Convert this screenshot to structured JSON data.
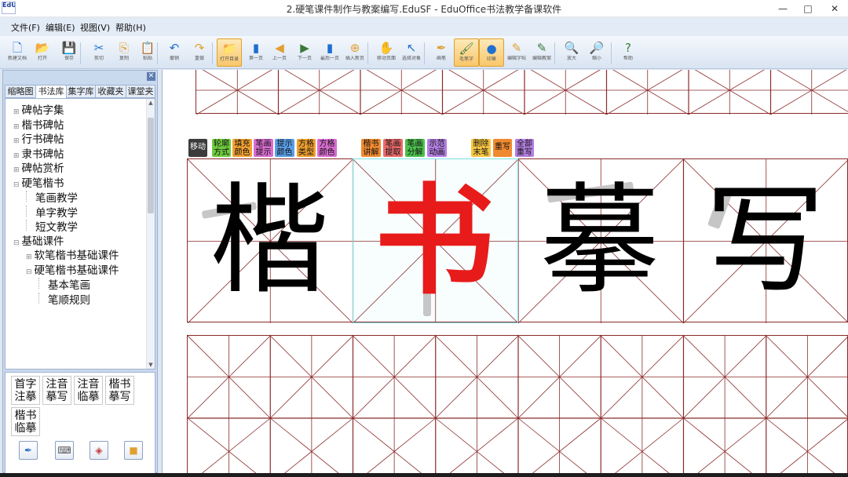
{
  "window": {
    "title": "2.硬笔课件制作与教案编写.EduSF - EduOffice书法教学备课软件",
    "logo_text": "EdU",
    "minimize": "—",
    "maximize": "□",
    "close": "✕"
  },
  "menu": [
    "文件(F)",
    "编辑(E)",
    "视图(V)",
    "帮助(H)"
  ],
  "toolbar": [
    {
      "icon": "new-file-icon",
      "glyph": "🗋",
      "label": "新建文档"
    },
    {
      "icon": "open-folder-icon",
      "glyph": "📂",
      "label": "打开"
    },
    {
      "icon": "save-icon",
      "glyph": "💾",
      "label": "保存"
    },
    {
      "icon": "cut-icon",
      "glyph": "✂",
      "label": "剪切"
    },
    {
      "icon": "copy-icon",
      "glyph": "⎘",
      "label": "复制"
    },
    {
      "icon": "paste-icon",
      "glyph": "📋",
      "label": "粘贴"
    },
    {
      "icon": "undo-icon",
      "glyph": "↶",
      "label": "撤销"
    },
    {
      "icon": "redo-icon",
      "glyph": "↷",
      "label": "重做"
    },
    {
      "icon": "folder-open-icon",
      "glyph": "📁",
      "label": "打开目录",
      "active": true
    },
    {
      "icon": "page-first-icon",
      "glyph": "▮",
      "label": "第一页"
    },
    {
      "icon": "page-prev-icon",
      "glyph": "◀",
      "label": "上一页"
    },
    {
      "icon": "page-next-icon",
      "glyph": "▶",
      "label": "下一页"
    },
    {
      "icon": "page-last-icon",
      "glyph": "▮",
      "label": "最后一页"
    },
    {
      "icon": "add-page-icon",
      "glyph": "⊕",
      "label": "插入新页"
    },
    {
      "icon": "hand-icon",
      "glyph": "✋",
      "label": "移动页面"
    },
    {
      "icon": "pointer-icon",
      "glyph": "↖",
      "label": "选择对象"
    },
    {
      "icon": "pen-icon",
      "glyph": "✒",
      "label": "画笔"
    },
    {
      "icon": "brush-icon",
      "glyph": "🖌",
      "label": "毛笔字",
      "active": true
    },
    {
      "icon": "stamp-icon",
      "glyph": "●",
      "label": "印章",
      "active": true
    },
    {
      "icon": "edit-template-icon",
      "glyph": "✎",
      "label": "编辑字帖"
    },
    {
      "icon": "edit-doc-icon",
      "glyph": "✎",
      "label": "编辑教案"
    },
    {
      "icon": "zoom-in-icon",
      "glyph": "🔍",
      "label": "放大"
    },
    {
      "icon": "zoom-out-icon",
      "glyph": "🔎",
      "label": "缩小"
    },
    {
      "icon": "help-icon",
      "glyph": "?",
      "label": "帮助"
    }
  ],
  "sidebar": {
    "close_glyph": "✕",
    "tabs": [
      "缩略图",
      "书法库",
      "集字库",
      "收藏夹",
      "课堂夹"
    ],
    "active_tab": 1,
    "tree": [
      {
        "label": "碑帖字集",
        "level": 0,
        "exp": "⊞"
      },
      {
        "label": "楷书碑帖",
        "level": 0,
        "exp": "⊞"
      },
      {
        "label": "行书碑帖",
        "level": 0,
        "exp": "⊞"
      },
      {
        "label": "隶书碑帖",
        "level": 0,
        "exp": "⊞"
      },
      {
        "label": "碑帖赏析",
        "level": 0,
        "exp": "⊞"
      },
      {
        "label": "硬笔楷书",
        "level": 0,
        "exp": "⊟"
      },
      {
        "label": "笔画教学",
        "level": 1,
        "exp": ""
      },
      {
        "label": "单字教学",
        "level": 1,
        "exp": ""
      },
      {
        "label": "短文教学",
        "level": 1,
        "exp": ""
      },
      {
        "label": "基础课件",
        "level": 0,
        "exp": "⊟"
      },
      {
        "label": "软笔楷书基础课件",
        "level": 1,
        "exp": "⊞"
      },
      {
        "label": "硬笔楷书基础课件",
        "level": 1,
        "exp": "⊟"
      },
      {
        "label": "基本笔画",
        "level": 2,
        "exp": ""
      },
      {
        "label": "笔顺规则",
        "level": 2,
        "exp": ""
      }
    ],
    "templates": [
      {
        "line1": "首字",
        "line2": "注摹"
      },
      {
        "line1": "注音",
        "line2": "摹写"
      },
      {
        "line1": "注音",
        "line2": "临摹"
      },
      {
        "line1": "楷书",
        "line2": "摹写"
      },
      {
        "line1": "楷书",
        "line2": "临摹"
      }
    ],
    "bottom_icons": [
      {
        "icon": "pen-tool-icon",
        "glyph": "✒"
      },
      {
        "icon": "keyboard-icon",
        "glyph": "⌨"
      },
      {
        "icon": "fill-icon",
        "glyph": "◈"
      },
      {
        "icon": "color-icon",
        "glyph": "■"
      }
    ]
  },
  "action_chips": [
    {
      "line1": "移动",
      "line2": "",
      "color": "#3b3b3b",
      "text": "#ffffff"
    },
    {
      "line1": "轮廓",
      "line2": "方式",
      "color": "#6ecb3f",
      "text": "#111111"
    },
    {
      "line1": "填充",
      "line2": "颜色",
      "color": "#f0a030",
      "text": "#111111"
    },
    {
      "line1": "笔画",
      "line2": "提示",
      "color": "#d76cd0",
      "text": "#111111"
    },
    {
      "line1": "提示",
      "line2": "颜色",
      "color": "#5a9ee8",
      "text": "#111111"
    },
    {
      "line1": "方格",
      "line2": "类型",
      "color": "#f0a030",
      "text": "#111111"
    },
    {
      "line1": "方格",
      "line2": "颜色",
      "color": "#d76cd0",
      "text": "#111111"
    },
    {
      "line1": "楷书",
      "line2": "讲解",
      "color": "#f08a30",
      "text": "#111111"
    },
    {
      "line1": "笔画",
      "line2": "提取",
      "color": "#e96a6a",
      "text": "#111111"
    },
    {
      "line1": "笔画",
      "line2": "分解",
      "color": "#4cbf4c",
      "text": "#111111"
    },
    {
      "line1": "示范",
      "line2": "动画",
      "color": "#b27ee0",
      "text": "#111111"
    },
    {
      "line1": "删除",
      "line2": "末笔",
      "color": "#f5c542",
      "text": "#111111"
    },
    {
      "line1": "重写",
      "line2": "",
      "color": "#f08a30",
      "text": "#111111"
    },
    {
      "line1": "全部",
      "line2": "重写",
      "color": "#b27ee0",
      "text": "#111111"
    }
  ],
  "characters": [
    {
      "char": "楷",
      "color": "#000000"
    },
    {
      "char": "书",
      "color": "#e81b1b"
    },
    {
      "char": "摹",
      "color": "#000000"
    },
    {
      "char": "写",
      "color": "#000000"
    }
  ],
  "colors": {
    "grid_line": "#8b2a2a",
    "selection": "#7fe0e0"
  }
}
